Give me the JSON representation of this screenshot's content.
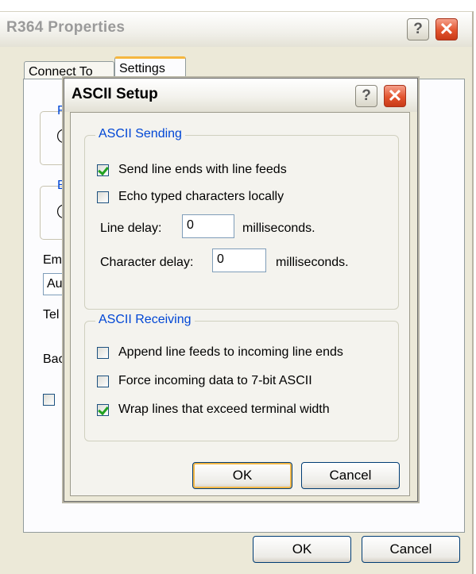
{
  "outer_window": {
    "title": "R364 Properties",
    "tabs": [
      {
        "label": "Connect To"
      },
      {
        "label": "Settings"
      }
    ],
    "clipped_labels": {
      "f_fragment": "F",
      "e_fragment": "E",
      "em_fragment": "Em",
      "au_fragment": "Au",
      "tel_fragment": "Tel",
      "bac_fragment": "Bac"
    },
    "ok_label": "OK",
    "cancel_label": "Cancel"
  },
  "dialog": {
    "title": "ASCII Setup",
    "sending": {
      "legend": "ASCII Sending",
      "options": [
        {
          "label": "Send line ends with line feeds",
          "checked": true
        },
        {
          "label": "Echo typed characters locally",
          "checked": false
        }
      ],
      "line_delay": {
        "label": "Line delay:",
        "value": "0",
        "unit": "milliseconds."
      },
      "char_delay": {
        "label": "Character delay:",
        "value": "0",
        "unit": "milliseconds."
      }
    },
    "receiving": {
      "legend": "ASCII Receiving",
      "options": [
        {
          "label": "Append line feeds to incoming line ends",
          "checked": false
        },
        {
          "label": "Force incoming data to 7-bit ASCII",
          "checked": false
        },
        {
          "label": "Wrap lines that exceed terminal width",
          "checked": true
        }
      ]
    },
    "ok_label": "OK",
    "cancel_label": "Cancel"
  },
  "icons": {
    "help": "?",
    "close": "✕"
  },
  "colors": {
    "window_face": "#ece9d8",
    "group_legend": "#0046d5",
    "checkmark": "#21a121",
    "close_button": "#e2542e",
    "default_button_ring": "#f3b848"
  }
}
